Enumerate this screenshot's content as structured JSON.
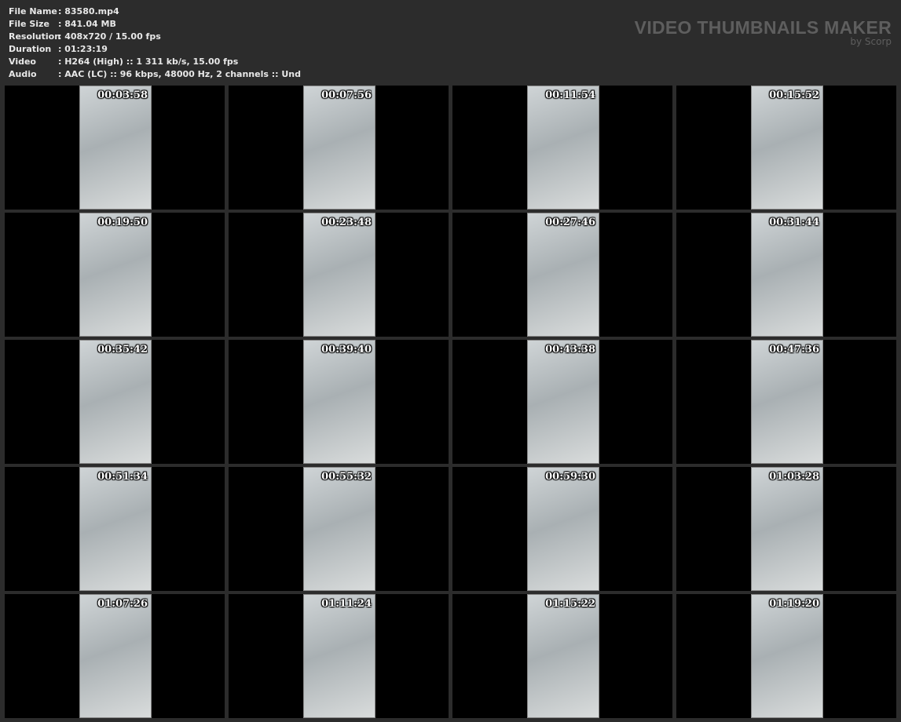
{
  "info": [
    {
      "label": "File Name",
      "value": ": 83580.mp4"
    },
    {
      "label": "File Size",
      "value": ": 841.04 MB"
    },
    {
      "label": "Resolution",
      "value": ": 408x720 / 15.00 fps"
    },
    {
      "label": "Duration",
      "value": ": 01:23:19"
    },
    {
      "label": "Video",
      "value": ": H264 (High) :: 1 311 kb/s, 15.00 fps"
    },
    {
      "label": "Audio",
      "value": ": AAC (LC) :: 96 kbps, 48000 Hz, 2 channels :: Und"
    }
  ],
  "brand": {
    "title": "VIDEO THUMBNAILS MAKER",
    "subtitle": "by Scorp"
  },
  "thumbnails": [
    "00:03:58",
    "00:07:56",
    "00:11:54",
    "00:15:52",
    "00:19:50",
    "00:23:48",
    "00:27:46",
    "00:31:44",
    "00:35:42",
    "00:39:40",
    "00:43:38",
    "00:47:36",
    "00:51:34",
    "00:55:32",
    "00:59:30",
    "01:03:28",
    "01:07:26",
    "01:11:24",
    "01:15:22",
    "01:19:20"
  ]
}
